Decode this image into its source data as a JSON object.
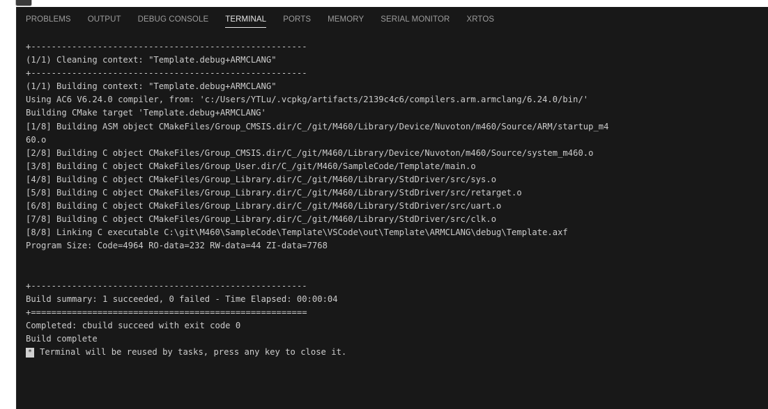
{
  "panel": {
    "tabs": [
      {
        "label": "PROBLEMS"
      },
      {
        "label": "OUTPUT"
      },
      {
        "label": "DEBUG CONSOLE"
      },
      {
        "label": "TERMINAL",
        "active": true
      },
      {
        "label": "PORTS"
      },
      {
        "label": "MEMORY"
      },
      {
        "label": "SERIAL MONITOR"
      },
      {
        "label": "XRTOS"
      }
    ]
  },
  "terminal": {
    "lines": [
      "+------------------------------------------------------",
      "(1/1) Cleaning context: \"Template.debug+ARMCLANG\"",
      "+------------------------------------------------------",
      "(1/1) Building context: \"Template.debug+ARMCLANG\"",
      "Using AC6 V6.24.0 compiler, from: 'c:/Users/YTLu/.vcpkg/artifacts/2139c4c6/compilers.arm.armclang/6.24.0/bin/'",
      "Building CMake target 'Template.debug+ARMCLANG'",
      "[1/8] Building ASM object CMakeFiles/Group_CMSIS.dir/C_/git/M460/Library/Device/Nuvoton/m460/Source/ARM/startup_m4",
      "60.o",
      "[2/8] Building C object CMakeFiles/Group_CMSIS.dir/C_/git/M460/Library/Device/Nuvoton/m460/Source/system_m460.o",
      "[3/8] Building C object CMakeFiles/Group_User.dir/C_/git/M460/SampleCode/Template/main.o",
      "[4/8] Building C object CMakeFiles/Group_Library.dir/C_/git/M460/Library/StdDriver/src/sys.o",
      "[5/8] Building C object CMakeFiles/Group_Library.dir/C_/git/M460/Library/StdDriver/src/retarget.o",
      "[6/8] Building C object CMakeFiles/Group_Library.dir/C_/git/M460/Library/StdDriver/src/uart.o",
      "[7/8] Building C object CMakeFiles/Group_Library.dir/C_/git/M460/Library/StdDriver/src/clk.o",
      "[8/8] Linking C executable C:\\git\\M460\\SampleCode\\Template\\VSCode\\out\\Template\\ARMCLANG\\debug\\Template.axf",
      "Program Size: Code=4964 RO-data=232 RW-data=44 ZI-data=7768",
      "",
      "",
      "+------------------------------------------------------",
      "Build summary: 1 succeeded, 0 failed - Time Elapsed: 00:00:04",
      "+======================================================",
      "Completed: cbuild succeed with exit code 0",
      "Build complete"
    ],
    "prompt_glyph": "*",
    "final_message": "Terminal will be reused by tasks, press any key to close it."
  }
}
